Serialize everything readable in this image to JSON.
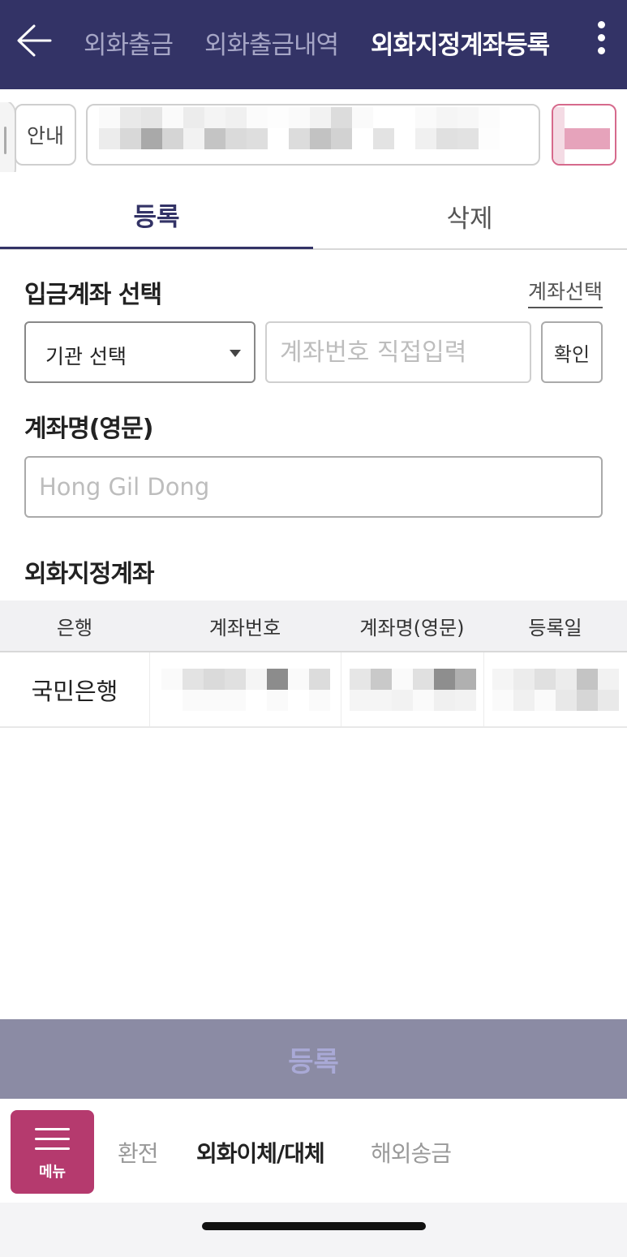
{
  "header": {
    "tabs": [
      {
        "label": "외화출금",
        "active": false
      },
      {
        "label": "외화출금내역",
        "active": false
      },
      {
        "label": "외화지정계좌등록",
        "active": true
      }
    ],
    "back_icon": "arrow-left-icon",
    "more_icon": "more-vertical-icon"
  },
  "notice": {
    "button_label": "안내"
  },
  "tabs": {
    "register_label": "등록",
    "delete_label": "삭제"
  },
  "deposit": {
    "title": "입금계좌 선택",
    "link_label": "계좌선택",
    "institution_select_value": "기관 선택",
    "account_placeholder": "계좌번호 직접입력",
    "confirm_label": "확인"
  },
  "account_name": {
    "title": "계좌명(영문)",
    "placeholder": "Hong Gil Dong"
  },
  "designated": {
    "title": "외화지정계좌",
    "columns": [
      "은행",
      "계좌번호",
      "계좌명(영문)",
      "등록일"
    ],
    "rows": [
      {
        "bank": "국민은행"
      }
    ]
  },
  "register_button_label": "등록",
  "bottom_nav": {
    "menu_label": "메뉴",
    "items": [
      {
        "label": "환전",
        "active": false
      },
      {
        "label": "외화이체/대체",
        "active": true
      },
      {
        "label": "해외송금",
        "active": false
      }
    ]
  },
  "colors": {
    "header_bg": "#333366",
    "accent": "#333366",
    "menu_bg": "#b53a6e",
    "register_bg": "#8b8ba4"
  }
}
